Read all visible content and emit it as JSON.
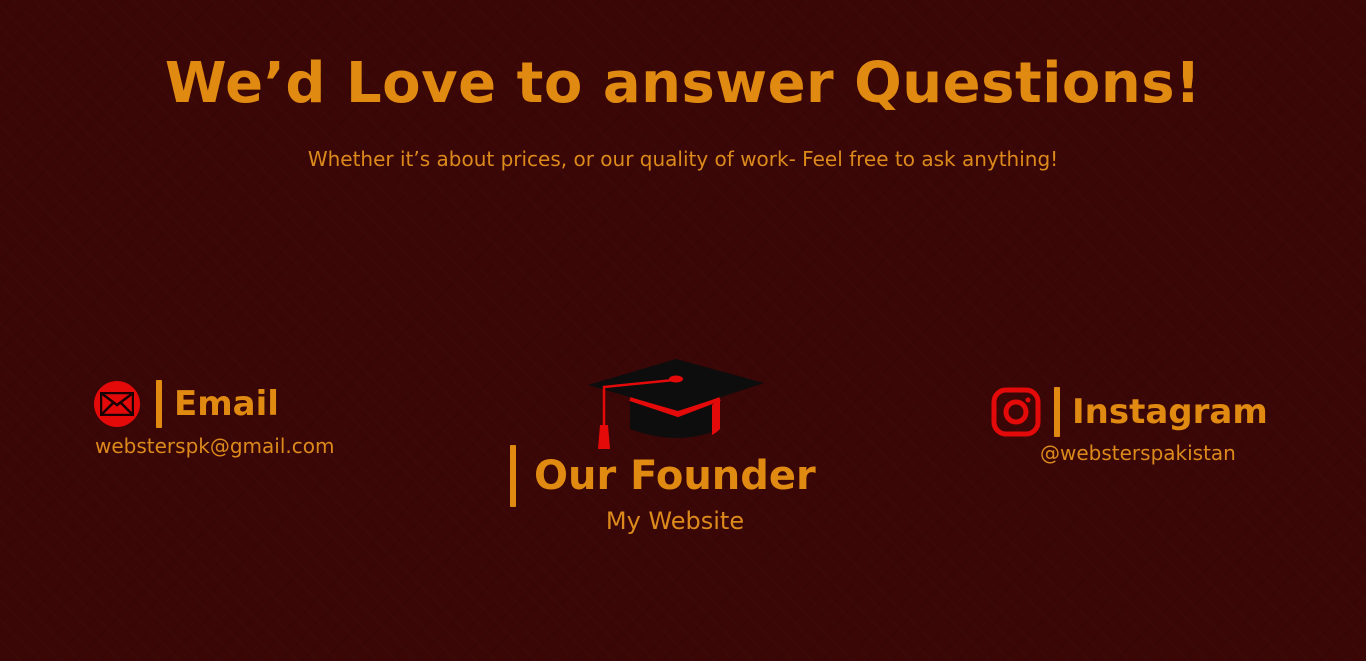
{
  "hero": {
    "title": "We’d Love to answer Questions!",
    "subtitle": "Whether it’s about prices, or our quality of work- Feel free to ask anything!"
  },
  "email": {
    "icon": "envelope-icon",
    "label": "Email",
    "value": "websterspk@gmail.com"
  },
  "founder": {
    "icon": "graduation-cap-icon",
    "label": "Our Founder",
    "value": "My Website"
  },
  "instagram": {
    "icon": "instagram-icon",
    "label": "Instagram",
    "value": "@websterspakistan"
  },
  "colors": {
    "background": "#3a0606",
    "accent_orange": "#e08a12",
    "icon_red": "#e40a0a",
    "cap_black": "#0d0d0d"
  }
}
